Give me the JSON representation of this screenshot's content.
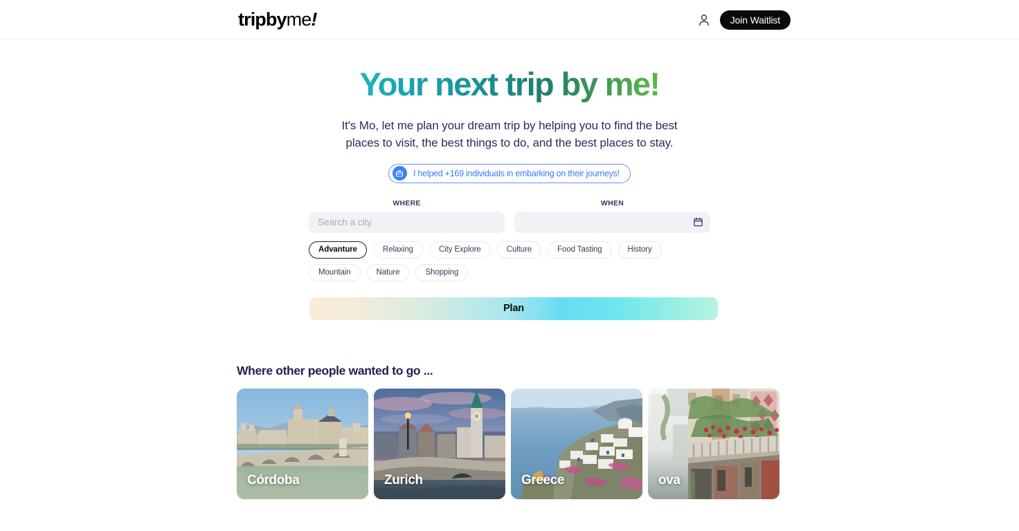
{
  "header": {
    "logo": {
      "part1": "tripby",
      "part2": "me",
      "part3": "!"
    },
    "user_icon": "person-icon",
    "waitlist_label": "Join Waitlist"
  },
  "hero": {
    "headline": "Your next trip by me!",
    "subtitle": "It's Mo, let me plan your dream trip by helping you to find the best places to visit, the best things to do, and the best places to stay.",
    "badge": {
      "icon": "suitcase-icon",
      "text": "I helped +169 individuals in embarking on their journeys!",
      "accent_color": "#3b7df6"
    }
  },
  "form": {
    "where": {
      "label": "WHERE",
      "placeholder": "Search a city",
      "value": ""
    },
    "when": {
      "label": "WHEN",
      "placeholder": "",
      "value": "",
      "icon": "calendar-icon"
    },
    "tags": [
      {
        "label": "Advanture",
        "selected": true
      },
      {
        "label": "Relaxing",
        "selected": false
      },
      {
        "label": "City Explore",
        "selected": false
      },
      {
        "label": "Culture",
        "selected": false
      },
      {
        "label": "Food Tasting",
        "selected": false
      },
      {
        "label": "History",
        "selected": false
      },
      {
        "label": "Mountain",
        "selected": false
      },
      {
        "label": "Nature",
        "selected": false
      },
      {
        "label": "Shopping",
        "selected": false
      }
    ],
    "plan_label": "Plan"
  },
  "destinations": {
    "title": "Where other people wanted to go ...",
    "cards": [
      {
        "label": "Córdoba"
      },
      {
        "label": "Zurich"
      },
      {
        "label": "Greece"
      },
      {
        "label": "ova"
      }
    ]
  }
}
